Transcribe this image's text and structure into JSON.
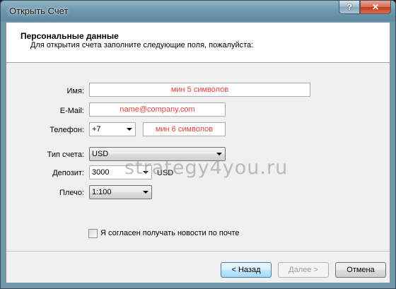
{
  "window": {
    "title": "Открыть Счет",
    "help_label": "?",
    "close_label": "✕"
  },
  "header": {
    "title": "Персональные данные",
    "subtitle": "Для открытия счета заполните следующие поля, пожалуйста:"
  },
  "form": {
    "name": {
      "label": "Имя:",
      "placeholder": "мин 5 символов"
    },
    "email": {
      "label": "E-Mail:",
      "placeholder": "name@company.com"
    },
    "phone": {
      "label": "Телефон:",
      "code": "+7",
      "placeholder": "мин 6 символов"
    },
    "account_type": {
      "label": "Тип счета:",
      "value": "USD"
    },
    "deposit": {
      "label": "Депозит:",
      "value": "3000",
      "unit": "USD"
    },
    "leverage": {
      "label": "Плечо:",
      "value": "1:100"
    },
    "newsletter": {
      "label": "Я согласен получать новости по почте",
      "checked": false
    }
  },
  "watermark": "strategy4you.ru",
  "buttons": {
    "back": "< Назад",
    "next": "Далее >",
    "cancel": "Отмена"
  }
}
